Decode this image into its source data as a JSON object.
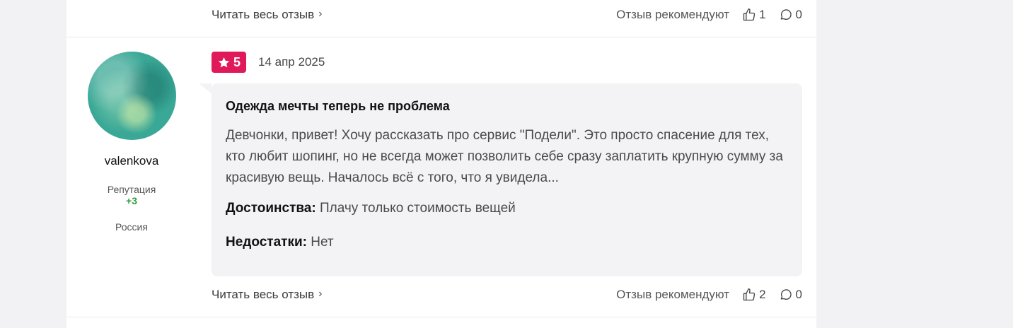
{
  "previous_review": {
    "read_more_label": "Читать весь отзыв",
    "recommend_label": "Отзыв рекомендуют",
    "likes": "1",
    "comments": "0"
  },
  "review": {
    "author": {
      "username": "valenkova",
      "reputation_label": "Репутация",
      "reputation_value": "+3",
      "country": "Россия"
    },
    "rating": "5",
    "date": "14 апр 2025",
    "title": "Одежда мечты теперь не проблема",
    "body": "Девчонки, привет! Хочу рассказать про сервис \"Подели\". Это просто спасение для тех, кто любит шопинг, но не всегда может позволить себе сразу заплатить крупную сумму за красивую вещь. Началось всё с того, что я увидела...",
    "pros_label": "Достоинства:",
    "pros_text": "Плачу только стоимость вещей",
    "cons_label": "Недостатки:",
    "cons_text": "Нет",
    "read_more_label": "Читать весь отзыв",
    "recommend_label": "Отзыв рекомендуют",
    "likes": "2",
    "comments": "0"
  },
  "colors": {
    "rating_badge": "#e0195a",
    "reputation_positive": "#2e9e3a",
    "bubble_bg": "#f3f3f6"
  },
  "icons": [
    "chevron-right-icon",
    "thumbs-up-icon",
    "comment-icon",
    "star-icon"
  ]
}
